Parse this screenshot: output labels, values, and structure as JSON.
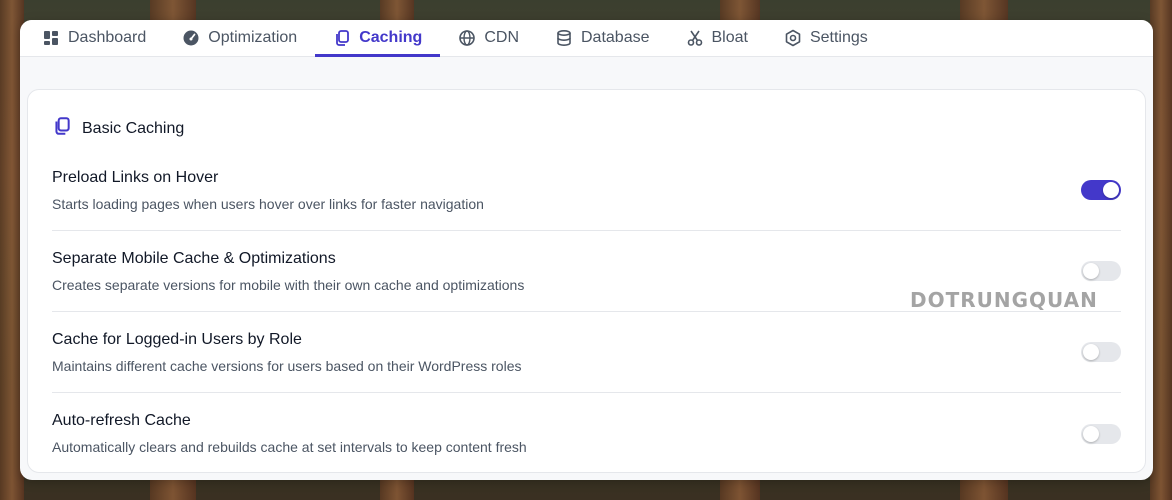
{
  "tabs": [
    {
      "label": "Dashboard",
      "icon": "dashboard-icon",
      "active": false
    },
    {
      "label": "Optimization",
      "icon": "gauge-icon",
      "active": false
    },
    {
      "label": "Caching",
      "icon": "copy-icon",
      "active": true
    },
    {
      "label": "CDN",
      "icon": "globe-icon",
      "active": false
    },
    {
      "label": "Database",
      "icon": "database-icon",
      "active": false
    },
    {
      "label": "Bloat",
      "icon": "scissors-icon",
      "active": false
    },
    {
      "label": "Settings",
      "icon": "gear-icon",
      "active": false
    }
  ],
  "section": {
    "title": "Basic Caching",
    "icon": "copy-icon"
  },
  "settings": [
    {
      "title": "Preload Links on Hover",
      "description": "Starts loading pages when users hover over links for faster navigation",
      "enabled": true
    },
    {
      "title": "Separate Mobile Cache & Optimizations",
      "description": "Creates separate versions for mobile with their own cache and optimizations",
      "enabled": false
    },
    {
      "title": "Cache for Logged-in Users by Role",
      "description": "Maintains different cache versions for users based on their WordPress roles",
      "enabled": false
    },
    {
      "title": "Auto-refresh Cache",
      "description": "Automatically clears and rebuilds cache at set intervals to keep content fresh",
      "enabled": false
    }
  ],
  "watermark": "DOTRUNGQUAN",
  "colors": {
    "accent": "#4338ca",
    "toggle_off": "#e5e7eb"
  }
}
